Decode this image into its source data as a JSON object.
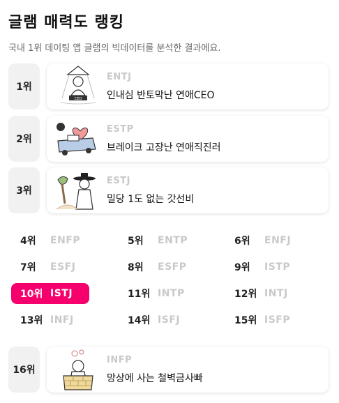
{
  "header": {
    "title": "글램 매력도 랭킹",
    "subtitle": "국내 1위 데이팅 앱 글램의 빅데이터를 분석한 결과에요."
  },
  "top_ranks": [
    {
      "rank": "1위",
      "type": "ENTJ",
      "name": "인내심 반토막난 연애CEO",
      "icon": "ceo-character-illustration"
    },
    {
      "rank": "2위",
      "type": "ESTP",
      "name": "브레이크 고장난 연애직진러",
      "icon": "car-heart-illustration"
    },
    {
      "rank": "3위",
      "type": "ESTJ",
      "name": "밀당 1도 없는 갓선비",
      "icon": "scholar-gat-illustration"
    }
  ],
  "grid_ranks": [
    {
      "rank": "4위",
      "type": "ENFP"
    },
    {
      "rank": "5위",
      "type": "ENTP"
    },
    {
      "rank": "6위",
      "type": "ENFJ"
    },
    {
      "rank": "7위",
      "type": "ESFJ"
    },
    {
      "rank": "8위",
      "type": "ESFP"
    },
    {
      "rank": "9위",
      "type": "ISTP"
    },
    {
      "rank": "10위",
      "type": "ISTJ",
      "highlighted": true
    },
    {
      "rank": "11위",
      "type": "INTP"
    },
    {
      "rank": "12위",
      "type": "INTJ"
    },
    {
      "rank": "13위",
      "type": "INFJ"
    },
    {
      "rank": "14위",
      "type": "ISFJ"
    },
    {
      "rank": "15위",
      "type": "ISFP"
    }
  ],
  "bottom_rank": {
    "rank": "16위",
    "type": "INFP",
    "name": "망상에 사는 철벽금사빠",
    "icon": "well-character-illustration"
  },
  "colors": {
    "highlight": "#f5006d",
    "muted_type": "#c9c9c9",
    "badge_bg": "#f1f1f1"
  }
}
